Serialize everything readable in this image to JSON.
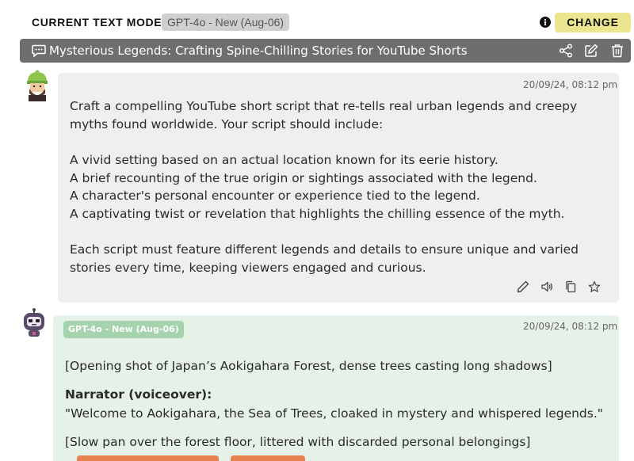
{
  "header": {
    "model_label": "CURRENT TEXT MODEL",
    "model_badge": "GPT-4o - New (Aug-06)",
    "change_button": "CHANGE"
  },
  "conversation": {
    "title": "Mysterious Legends: Crafting Spine-Chilling Stories for YouTube Shorts"
  },
  "messages": {
    "user": {
      "timestamp": "20/09/24, 08:12 pm",
      "lines": [
        "Craft a compelling YouTube short script that re-tells real urban legends and creepy",
        "myths found worldwide. Your script should include:",
        "A vivid setting based on an actual location known for its eerie history.",
        "A brief recounting of the true origin or sightings associated with the legend.",
        "A character's personal encounter or experience tied to the legend.",
        "A captivating twist or revelation that highlights the chilling essence of the myth.",
        "Each script must feature different legends and details to ensure unique and varied",
        "stories every time, keeping viewers engaged and curious."
      ]
    },
    "assistant": {
      "model_badge": "GPT-4o - New (Aug-06)",
      "timestamp": "20/09/24, 08:12 pm",
      "opening": "[Opening shot of Japan’s Aokigahara Forest, dense trees casting long shadows]",
      "narrator_label": "Narrator (voiceover):",
      "narrator_line": "\"Welcome to Aokigahara, the Sea of Trees, cloaked in mystery and whispered legends.\"",
      "pan": "[Slow pan over the forest floor, littered with discarded personal belongings]"
    }
  },
  "colors": {
    "change_button": "#ece58f",
    "title_bar": "#6e6e6e",
    "user_bubble": "#efefef",
    "assistant_bubble": "#e6f2e8",
    "assistant_badge": "#a5d3ae",
    "footer_buttons": "#e8824f"
  },
  "icons": {
    "info": "info-icon",
    "chat": "chat-bubble-icon",
    "share": "share-icon",
    "edit": "edit-icon",
    "delete": "trash-icon",
    "message_edit": "pencil-icon",
    "speak": "speaker-icon",
    "copy": "copy-icon",
    "favorite": "star-icon"
  }
}
